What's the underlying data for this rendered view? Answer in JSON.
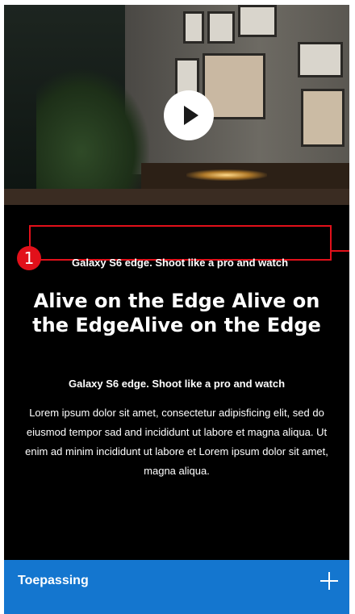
{
  "marker": {
    "number": "1"
  },
  "content": {
    "eyebrow": "Galaxy S6 edge. Shoot like a pro and watch",
    "headline": "Alive on the Edge Alive on the EdgeAlive on the Edge",
    "subhead": "Galaxy S6 edge. Shoot like a pro and watch",
    "body": "Lorem ipsum dolor sit amet, consectetur adipisficing elit, sed do eiusmod tempor sad and incididunt ut labore et magna aliqua. Ut enim ad minim incididunt ut labore et Lorem ipsum dolor sit amet, magna aliqua."
  },
  "accordion": {
    "label": "Toepassing"
  },
  "icons": {
    "play": "play-icon",
    "expand": "plus-icon"
  },
  "colors": {
    "background": "#000000",
    "accordion": "#1476cf",
    "annotation": "#e2101a",
    "text": "#ffffff"
  }
}
